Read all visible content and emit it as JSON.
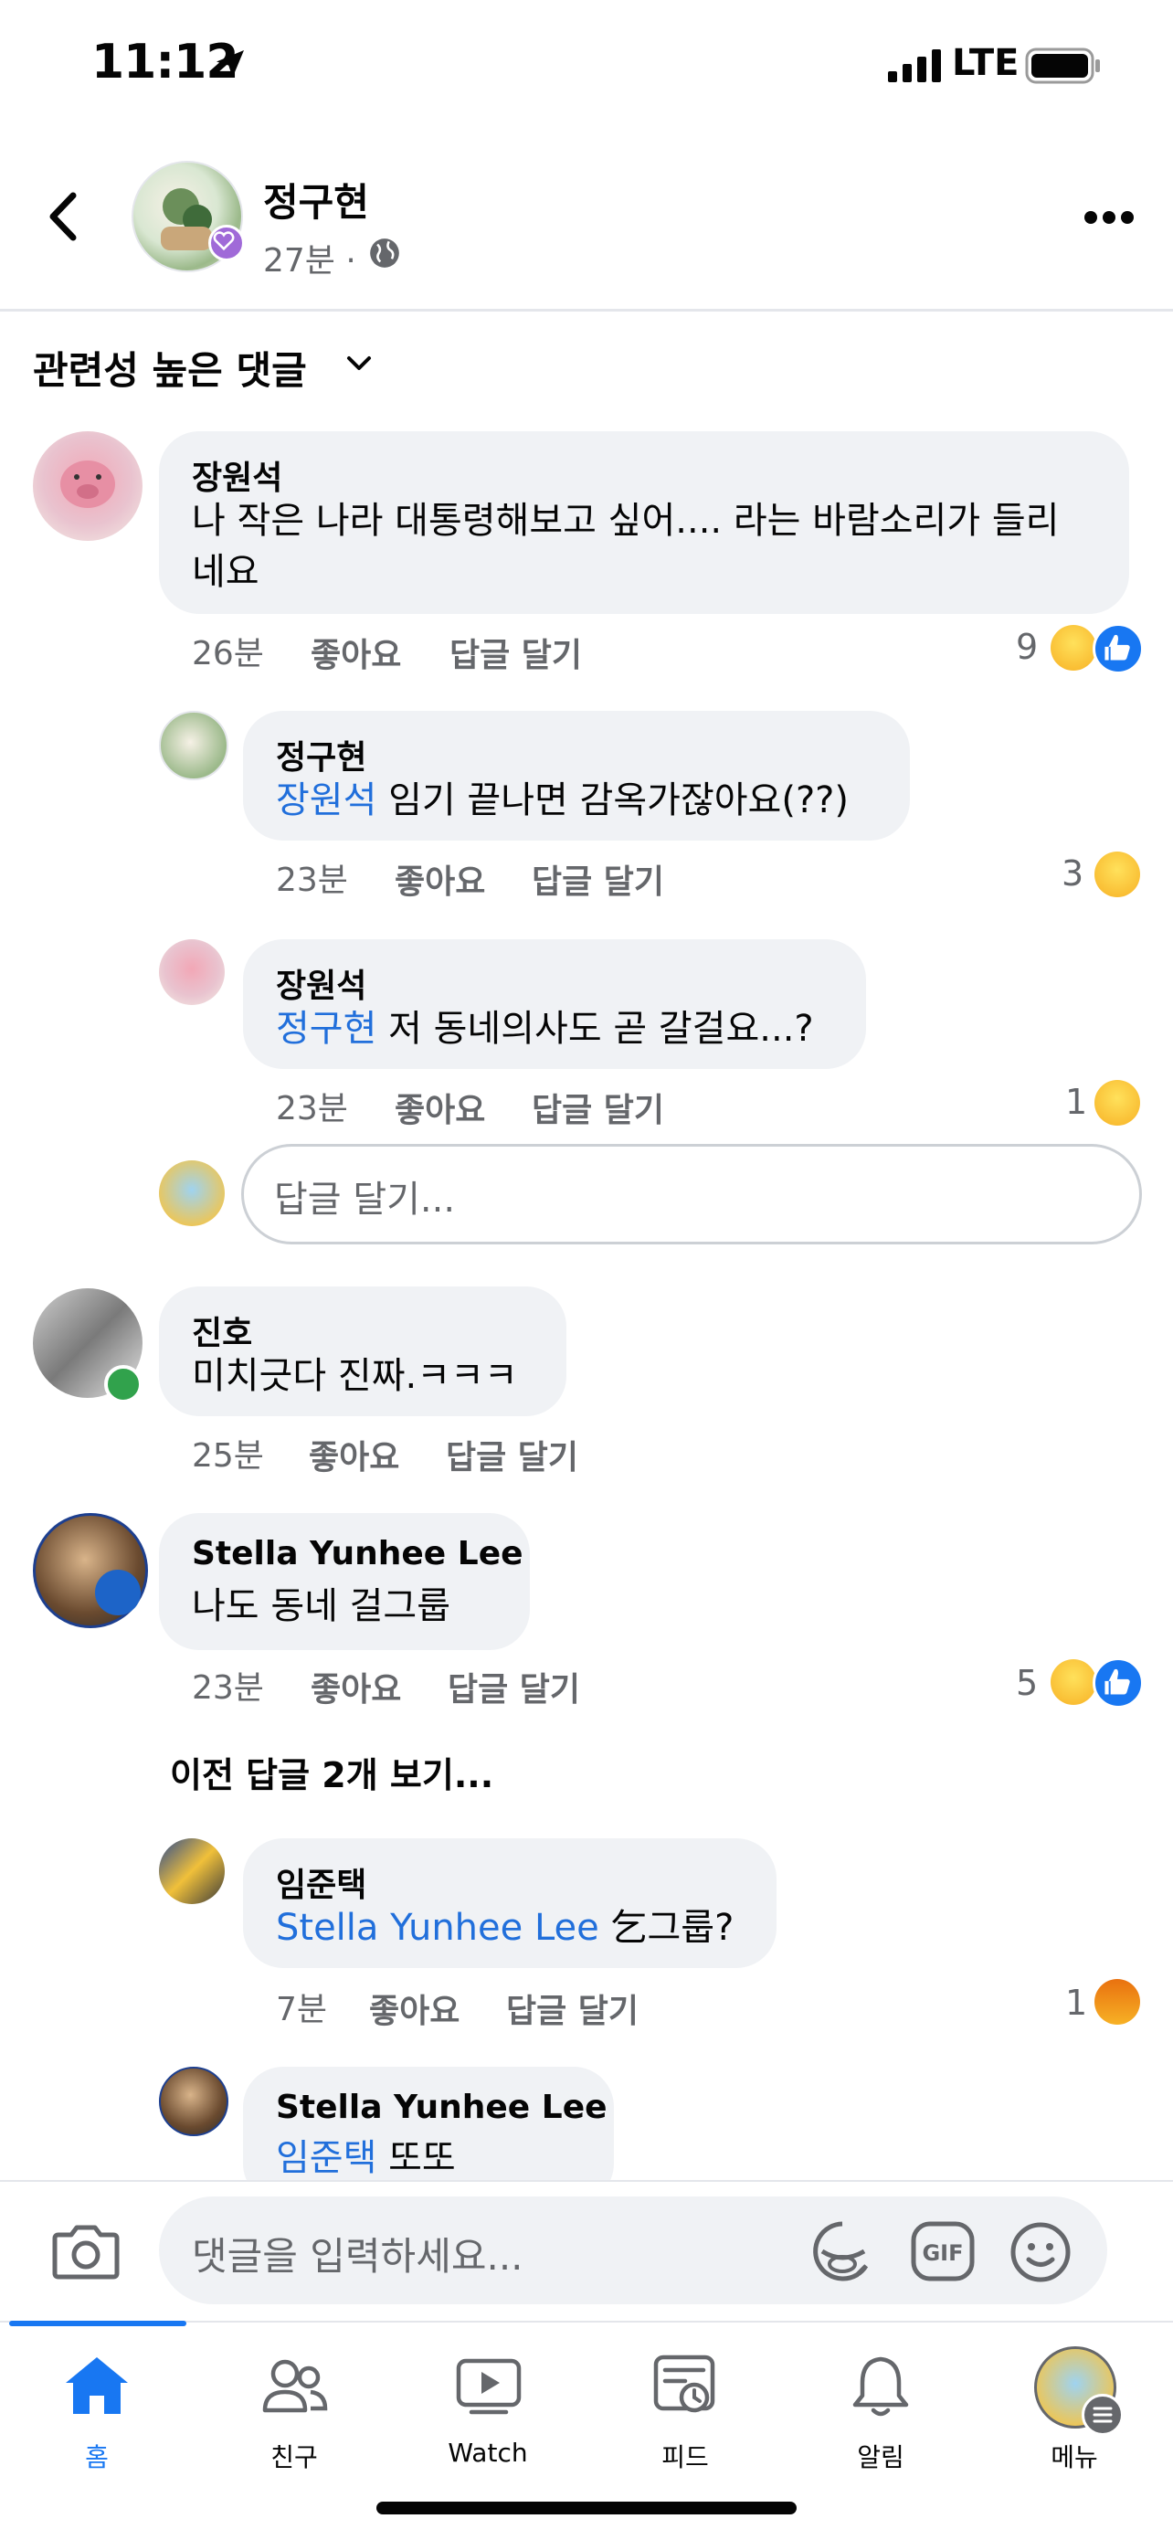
{
  "status_bar": {
    "time": "11:12",
    "network": "LTE"
  },
  "post_header": {
    "author": "정구현",
    "time": "27분",
    "separator": "·"
  },
  "sort": {
    "label": "관련성 높은 댓글"
  },
  "comments": [
    {
      "author": "장원석",
      "text": "나 작은 나라 대통령해보고 싶어.... 라는 바람소리가 들리",
      "text2": "네요",
      "time": "26분",
      "like": "좋아요",
      "reply": "답글 달기",
      "reactions": "9"
    },
    {
      "author": "정구현",
      "mention": "장원석",
      "text": " 임기 끝나면 감옥가잖아요(??)",
      "time": "23분",
      "like": "좋아요",
      "reply": "답글 달기",
      "reactions": "3"
    },
    {
      "author": "장원석",
      "mention": "정구현",
      "text": " 저 동네의사도 곧 갈걸요...?",
      "time": "23분",
      "like": "좋아요",
      "reply": "답글 달기",
      "reactions": "1"
    },
    {
      "author": "진호",
      "text": "미치긋다 진짜.ㅋㅋㅋ",
      "time": "25분",
      "like": "좋아요",
      "reply": "답글 달기"
    },
    {
      "author": "Stella Yunhee Lee",
      "text": "나도 동네 걸그룹",
      "time": "23분",
      "like": "좋아요",
      "reply": "답글 달기",
      "reactions": "5"
    },
    {
      "author": "임준택",
      "mention": "Stella Yunhee Lee",
      "text": " 乞그룹?",
      "time": "7분",
      "like": "좋아요",
      "reply": "답글 달기",
      "reactions": "1"
    },
    {
      "author": "Stella Yunhee Lee",
      "mention": "임준택",
      "text": " 또또"
    }
  ],
  "reply_box": {
    "placeholder": "답글 달기..."
  },
  "see_previous": "이전 답글 2개 보기...",
  "composer": {
    "placeholder": "댓글을 입력하세요..."
  },
  "tabs": [
    {
      "label": "홈",
      "active": true
    },
    {
      "label": "친구"
    },
    {
      "label": "Watch"
    },
    {
      "label": "피드"
    },
    {
      "label": "알림"
    },
    {
      "label": "메뉴"
    }
  ],
  "colors": {
    "accent": "#1877f2",
    "mention": "#216fdb",
    "bubble": "#f0f2f5",
    "secondary_text": "#65676b"
  }
}
